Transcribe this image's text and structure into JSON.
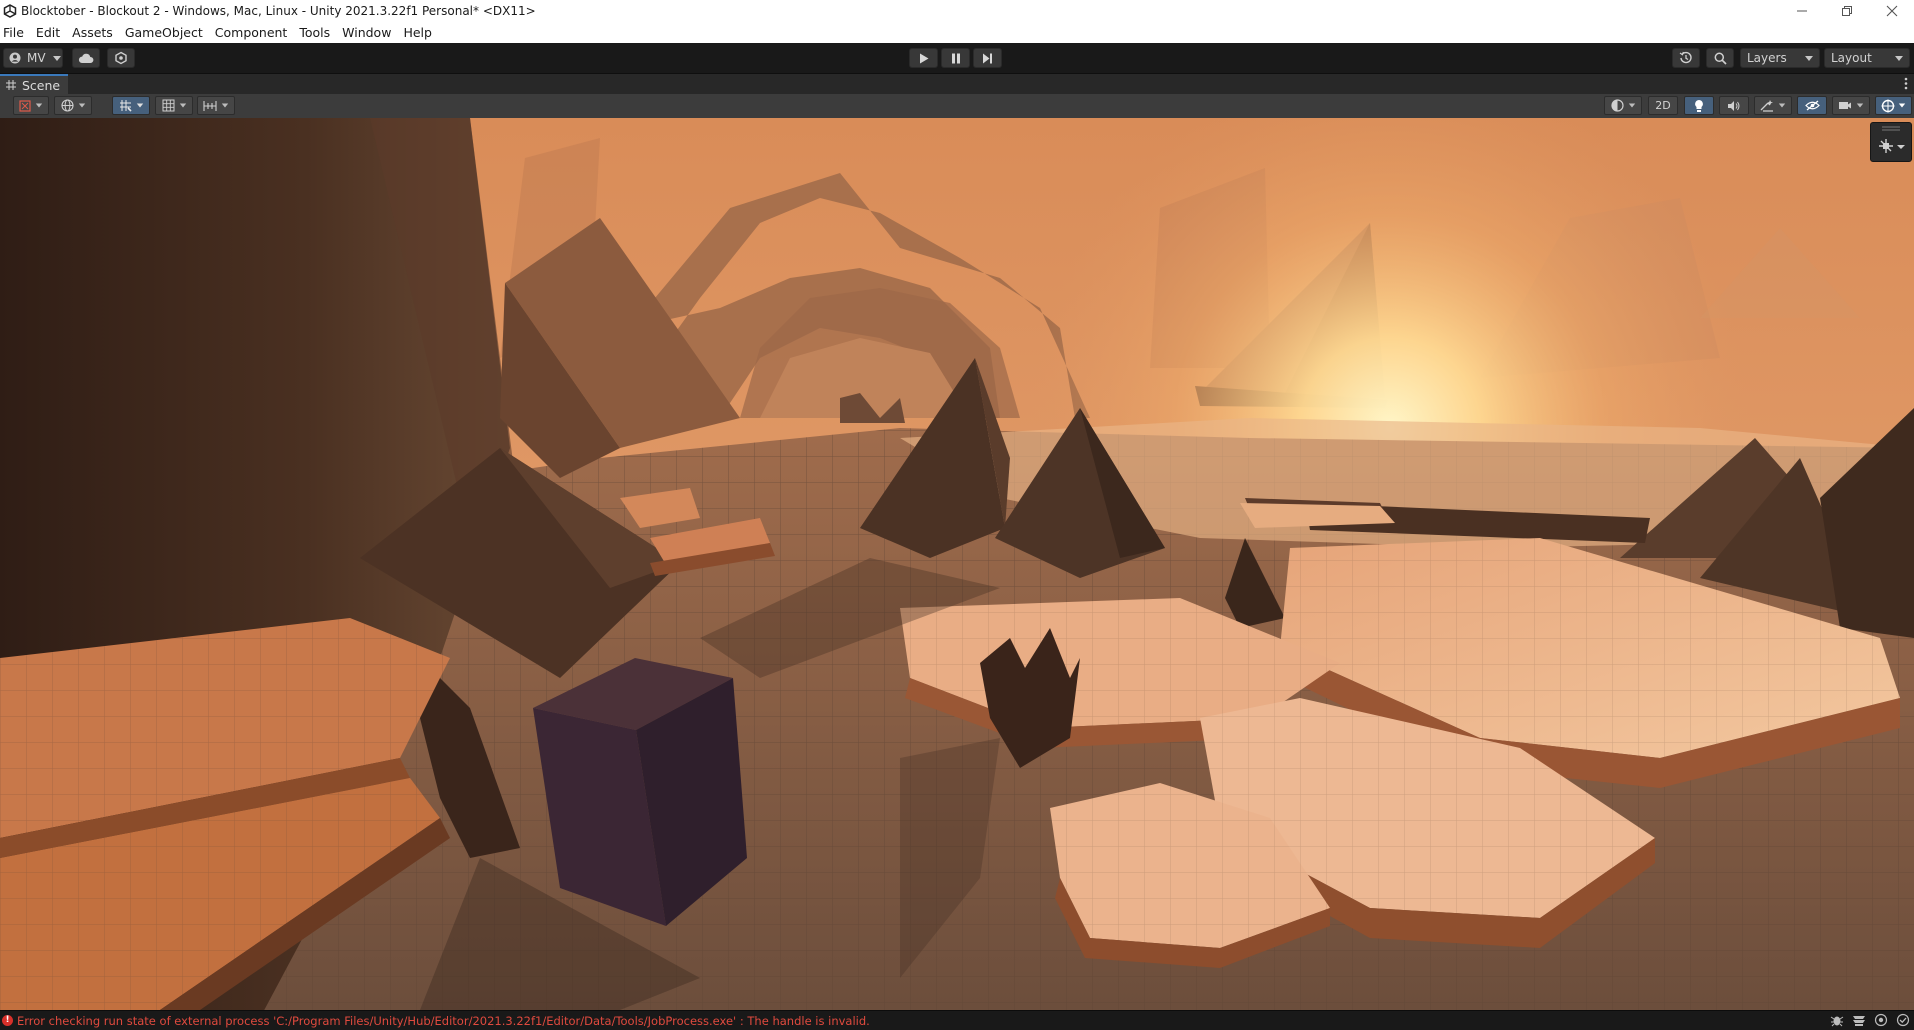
{
  "window": {
    "title": "Blocktober - Blockout 2 - Windows, Mac, Linux - Unity 2021.3.22f1 Personal* <DX11>"
  },
  "menu": {
    "items": [
      "File",
      "Edit",
      "Assets",
      "GameObject",
      "Component",
      "Tools",
      "Window",
      "Help"
    ]
  },
  "toolbar": {
    "account_label": "MV",
    "layers_label": "Layers",
    "layout_label": "Layout"
  },
  "scene_tab": {
    "label": "Scene"
  },
  "scene_toolbar": {
    "mode_2d_label": "2D"
  },
  "status": {
    "message": "Error checking run state of external process 'C:/Program Files/Unity/Hub/Editor/2021.3.22f1/Editor/Data/Tools/JobProcess.exe' : The handle is invalid."
  },
  "icons": [
    "unity-logo-icon",
    "minimize-icon",
    "maximize-icon",
    "close-icon",
    "account-icon",
    "cloud-icon",
    "collab-icon",
    "play-icon",
    "pause-icon",
    "step-icon",
    "history-icon",
    "search-icon",
    "scene-grid-icon",
    "more-icon",
    "transform-tool-icon",
    "global-icon",
    "snap-icon",
    "grid-icon",
    "incremental-snap-icon",
    "shading-icon",
    "lighting-icon",
    "audio-icon",
    "effects-icon",
    "hidden-objects-icon",
    "camera-icon",
    "gizmos-icon",
    "orientation-gizmo-icon",
    "error-icon"
  ],
  "colors": {
    "status_error": "#e04a3e",
    "active_toggle": "#46607c",
    "sky": "#d89463",
    "sun_glow": "#fff3c2"
  }
}
